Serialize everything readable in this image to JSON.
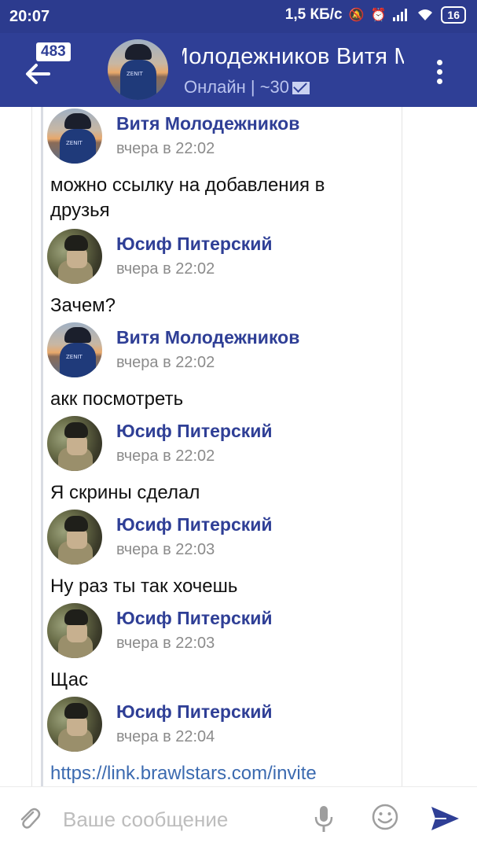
{
  "status_bar": {
    "time": "20:07",
    "network_speed": "1,5 КБ/с",
    "battery": "16"
  },
  "header": {
    "unread_count": "483",
    "title": "Витя Молодежников      Витя Молодежников",
    "status": "Онлайн | ~30",
    "icons": [
      "back-arrow-icon",
      "mail-icon",
      "more-vert-icon"
    ]
  },
  "messages": [
    {
      "author": "Витя Молодежников",
      "time": "вчера в 22:02",
      "text": "можно ссылку на добавления в друзья",
      "avatar": "sunset"
    },
    {
      "author": "Юсиф Питерский",
      "time": "вчера в 22:02",
      "text": "Зачем?",
      "avatar": "camo"
    },
    {
      "author": "Витя Молодежников",
      "time": "вчера в 22:02",
      "text": "акк посмотреть",
      "avatar": "sunset"
    },
    {
      "author": "Юсиф Питерский",
      "time": "вчера в 22:02",
      "text": "Я скрины сделал",
      "avatar": "camo"
    },
    {
      "author": "Юсиф Питерский",
      "time": "вчера в 22:03",
      "text": "Ну раз ты так хочешь",
      "avatar": "camo"
    },
    {
      "author": "Юсиф Питерский",
      "time": "вчера в 22:03",
      "text": "Щас",
      "avatar": "camo"
    },
    {
      "author": "Юсиф Питерский",
      "time": "вчера в 22:04",
      "text": "https://link.brawlstars.com/invite",
      "avatar": "camo"
    }
  ],
  "composer": {
    "placeholder": "Ваше сообщение"
  },
  "colors": {
    "header_bg": "#2f3f96",
    "status_bar_bg": "#2c3b8e",
    "author_name": "#2f3f96",
    "link": "#3b6ab0"
  }
}
